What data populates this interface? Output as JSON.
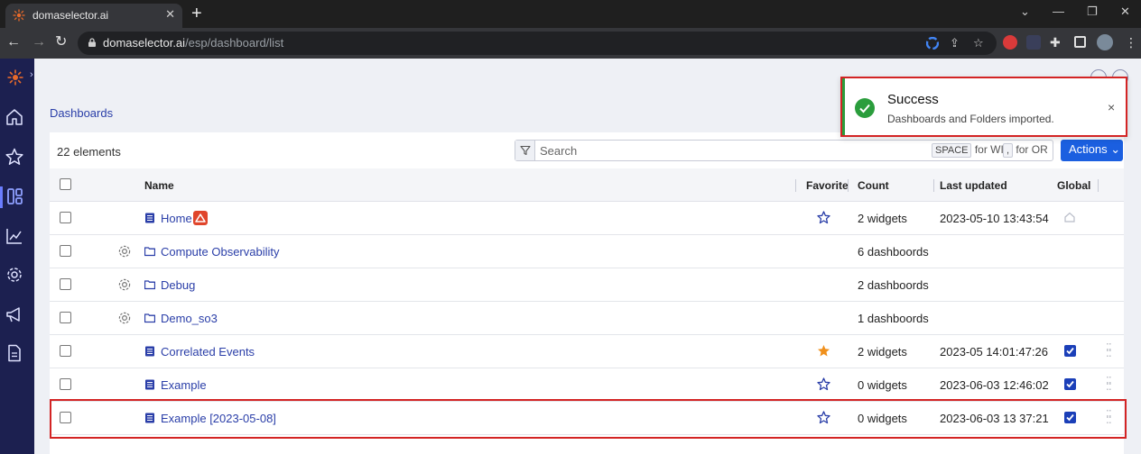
{
  "browser": {
    "tab_title": "domaselector.ai",
    "tab_close": "✕",
    "new_tab": "+",
    "url_host": "domaselector.ai",
    "url_path": "/esp/dashboard/list",
    "window_controls": [
      "⌄",
      "—",
      "❐",
      "✕"
    ]
  },
  "page": {
    "breadcrumb": "Dashboards",
    "element_count": "22 elements",
    "search_placeholder": "Search",
    "hint_space_key": "SPACE",
    "hint_space_text": "for WID",
    "hint_or_key": ",",
    "hint_or_text": "for OR",
    "actions_label": "Actions ⌄"
  },
  "table": {
    "headers": {
      "name": "Name",
      "favorite": "Favorite",
      "count": "Count",
      "last_updated": "Last updated",
      "global": "Global"
    },
    "rows": [
      {
        "name": "Home",
        "kind": "dashboard",
        "count": "2 widgets",
        "updated": "2023-05-10 13:43:54",
        "favorite": false,
        "global": "home"
      },
      {
        "name": "Compute Observability",
        "kind": "folder",
        "count": "6 dashboords",
        "updated": "",
        "favorite": null,
        "global": null
      },
      {
        "name": "Debug",
        "kind": "folder",
        "count": "2 dashboords",
        "updated": "",
        "favorite": null,
        "global": null
      },
      {
        "name": "Demo_so3",
        "kind": "folder",
        "count": "1 dashboords",
        "updated": "",
        "favorite": null,
        "global": null
      },
      {
        "name": "Correlated Events",
        "kind": "dashboard",
        "count": "2 widgets",
        "updated": "2023-05 14:01:47:26",
        "favorite": true,
        "global": true
      },
      {
        "name": "Example",
        "kind": "dashboard",
        "count": "0 widgets",
        "updated": "2023-06-03 12:46:02",
        "favorite": false,
        "global": true
      },
      {
        "name": "Example [2023-05-08]",
        "kind": "dashboard",
        "count": "0 widgets",
        "updated": "2023-06-03 13 37:21",
        "favorite": false,
        "global": true
      }
    ]
  },
  "toast": {
    "title": "Success",
    "message": "Dashboards and Folders imported.",
    "close": "×"
  },
  "colors": {
    "nav_bg": "#1c2050",
    "link": "#2a3ea8",
    "primary": "#1b5fe0",
    "success": "#2a9d3c",
    "favorite_on": "#f0901c",
    "highlight": "#d32424"
  }
}
